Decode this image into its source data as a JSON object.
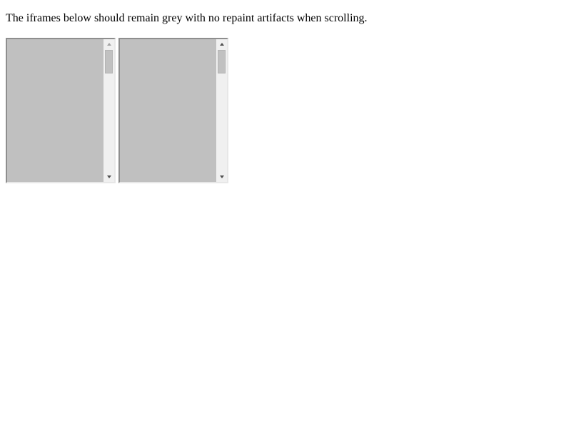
{
  "page": {
    "instructions": "The iframes below should remain grey with no repaint artifacts when scrolling."
  },
  "frames": [
    {
      "scrollbar": {
        "position": 0,
        "up_arrow_icon": "chevron-up-icon",
        "down_arrow_icon": "chevron-down-icon",
        "up_arrow_enabled": false
      }
    },
    {
      "scrollbar": {
        "position": 0,
        "up_arrow_icon": "chevron-up-icon",
        "down_arrow_icon": "chevron-down-icon",
        "up_arrow_enabled": true
      }
    }
  ],
  "colors": {
    "frame_background": "#c0c0c0",
    "page_background": "#ffffff"
  }
}
